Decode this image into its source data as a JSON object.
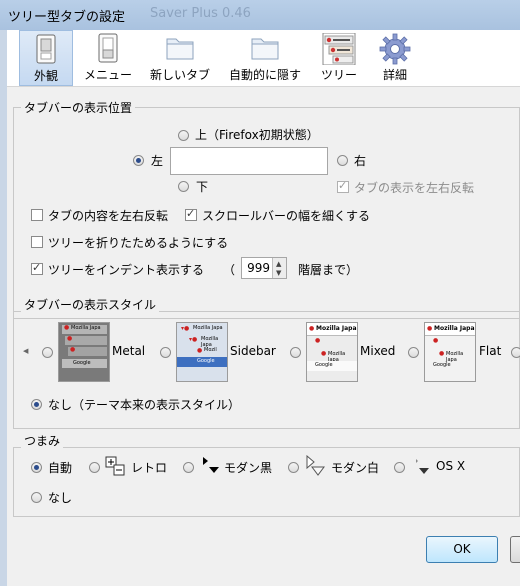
{
  "window": {
    "title": "ツリー型タブの設定",
    "ghost_title": "Saver Plus 0.46"
  },
  "toolbar": {
    "tabs": [
      {
        "label": "外観",
        "icon": "switch-icon",
        "active": true
      },
      {
        "label": "メニュー",
        "icon": "switch-icon"
      },
      {
        "label": "新しいタブ",
        "icon": "folder-icon"
      },
      {
        "label": "自動的に隠す",
        "icon": "folder-icon"
      },
      {
        "label": "ツリー",
        "icon": "tree-tabs-icon"
      },
      {
        "label": "詳細",
        "icon": "gear-icon"
      }
    ]
  },
  "position_group": {
    "title": "タブバーの表示位置",
    "top_label": "上（Firefox初期状態）",
    "left_label": "左",
    "right_label": "右",
    "bottom_label": "下",
    "selected": "left",
    "invert_label": "タブの表示を左右反転",
    "invert_checked": true,
    "invert_disabled": true,
    "invert_content_label": "タブの内容を左右反転",
    "invert_content_checked": false,
    "narrow_scrollbar_label": "スクロールバーの幅を細くする",
    "narrow_scrollbar_checked": true,
    "collapsible_label": "ツリーを折りたためるようにする",
    "collapsible_checked": false,
    "indent_label": "ツリーをインデント表示する",
    "indent_checked": true,
    "indent_open_paren": "（",
    "indent_levels": "999",
    "indent_suffix": "階層まで）"
  },
  "style_group": {
    "title": "タブバーの表示スタイル",
    "styles": [
      {
        "label": "Metal"
      },
      {
        "label": "Sidebar"
      },
      {
        "label": "Mixed"
      },
      {
        "label": "Flat"
      }
    ],
    "thumb_texts": {
      "mozilla": "Mozilla Japa",
      "mozilla_short": "Mozil",
      "google": "Google"
    },
    "none_label": "なし（テーマ本来の表示スタイル）",
    "selected": "none"
  },
  "twisty_group": {
    "title": "つまみ",
    "options": [
      {
        "label": "自動",
        "icon": "",
        "selected": true
      },
      {
        "label": "レトロ",
        "icon": "plus-minus-icon"
      },
      {
        "label": "モダン黒",
        "icon": "black-triangle-icon"
      },
      {
        "label": "モダン白",
        "icon": "white-triangle-icon"
      },
      {
        "label": "OS X",
        "icon": "osx-triangle-icon"
      },
      {
        "label": "なし",
        "icon": ""
      }
    ]
  },
  "footer": {
    "ok_label": "OK"
  },
  "colors": {
    "accent": "#2c4c8c",
    "title_bar": "#b9cfe8",
    "ok_border": "#3c7fb1"
  }
}
